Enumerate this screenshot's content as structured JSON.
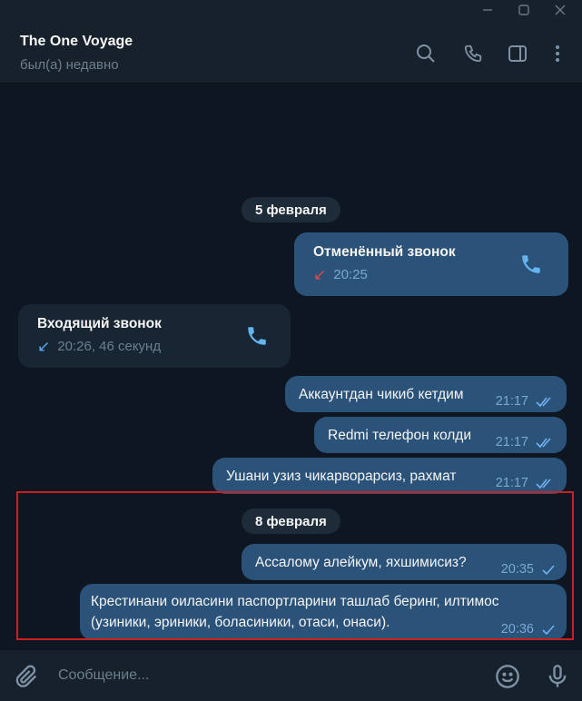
{
  "window": {
    "minimize_icon": "minimize-icon",
    "maximize_icon": "maximize-icon",
    "close_icon": "close-icon"
  },
  "header": {
    "title": "The One Voyage",
    "status": "был(а) недавно",
    "icons": [
      "search-icon",
      "phone-icon",
      "sidebar-toggle-icon",
      "more-vertical-icon"
    ]
  },
  "messages": {
    "date1": "5 февраля",
    "call_cancelled": {
      "title": "Отменённый звонок",
      "time": "20:25",
      "arrow": "↙",
      "arrow_color": "#e0484e"
    },
    "call_incoming": {
      "title": "Входящий звонок",
      "detail": "20:26, 46 секунд",
      "arrow": "↙",
      "arrow_color": "#5aa9ec"
    },
    "m1": {
      "text": "Аккаунтдан чикиб кетдим",
      "time": "21:17"
    },
    "m2": {
      "text": "Redmi телефон колди",
      "time": "21:17"
    },
    "m3": {
      "text": "Ушани узиз чикарворарсиз, рахмат",
      "time": "21:17"
    },
    "date2": "8 февраля",
    "m4": {
      "text": "Ассалому алейкум, яхшимисиз?",
      "time": "20:35"
    },
    "m5": {
      "line1": "Крестинани оиласини паспортларини ташлаб беринг, илтимос",
      "line2": "(узиники, эриники, боласиники, отаси, онаси).",
      "time": "20:36"
    }
  },
  "composer": {
    "placeholder": "Сообщение...",
    "icons": [
      "paperclip-icon",
      "emoji-icon",
      "microphone-icon"
    ]
  },
  "colors": {
    "background": "#0e1621",
    "panel": "#17212b",
    "outgoing_bubble": "#2b5278",
    "incoming_bubble": "#182533",
    "accent": "#64b5ef",
    "highlight_border": "#cc1f1f"
  }
}
